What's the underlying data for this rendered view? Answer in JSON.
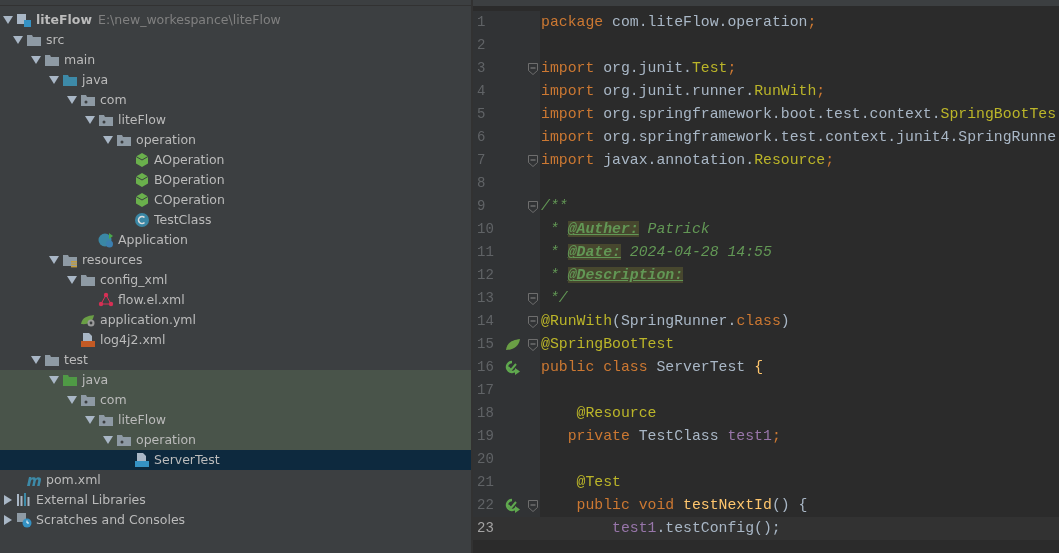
{
  "project_tree": [
    {
      "label": "liteFlow",
      "path": "E:\\new_workespance\\liteFlow",
      "kind": "module",
      "expanded": true,
      "children": [
        {
          "label": "src",
          "kind": "folder",
          "expanded": true,
          "children": [
            {
              "label": "main",
              "kind": "folder",
              "expanded": true,
              "children": [
                {
                  "label": "java",
                  "kind": "source-folder",
                  "expanded": true,
                  "children": [
                    {
                      "label": "com",
                      "kind": "package",
                      "expanded": true,
                      "children": [
                        {
                          "label": "liteFlow",
                          "kind": "package",
                          "expanded": true,
                          "children": [
                            {
                              "label": "operation",
                              "kind": "package",
                              "expanded": true,
                              "children": [
                                {
                                  "label": "AOperation",
                                  "kind": "bean",
                                  "selected": false
                                },
                                {
                                  "label": "BOperation",
                                  "kind": "bean",
                                  "selected": false
                                },
                                {
                                  "label": "COperation",
                                  "kind": "bean",
                                  "selected": false
                                },
                                {
                                  "label": "TestClass",
                                  "kind": "class",
                                  "selected": false
                                }
                              ]
                            }
                          ]
                        },
                        {
                          "label": "Application",
                          "kind": "app",
                          "selected": false
                        }
                      ]
                    }
                  ]
                },
                {
                  "label": "resources",
                  "kind": "resources-folder",
                  "expanded": true,
                  "children": [
                    {
                      "label": "config_xml",
                      "kind": "folder",
                      "expanded": true,
                      "children": [
                        {
                          "label": "flow.el.xml",
                          "kind": "flow-xml",
                          "selected": false
                        }
                      ]
                    },
                    {
                      "label": "application.yml",
                      "kind": "yml",
                      "selected": false
                    },
                    {
                      "label": "log4j2.xml",
                      "kind": "xml",
                      "selected": false
                    }
                  ]
                }
              ]
            },
            {
              "label": "test",
              "kind": "folder",
              "expanded": true,
              "children": [
                {
                  "label": "java",
                  "kind": "test-folder",
                  "expanded": true,
                  "test_sources": true,
                  "children": [
                    {
                      "label": "com",
                      "kind": "package",
                      "expanded": true,
                      "children": [
                        {
                          "label": "liteFlow",
                          "kind": "package",
                          "expanded": true,
                          "children": [
                            {
                              "label": "operation",
                              "kind": "package",
                              "expanded": true,
                              "children": [
                                {
                                  "label": "ServerTest",
                                  "kind": "test-class",
                                  "selected": true
                                }
                              ]
                            }
                          ]
                        }
                      ]
                    }
                  ]
                }
              ]
            }
          ]
        },
        {
          "label": "pom.xml",
          "kind": "maven",
          "selected": false
        }
      ]
    },
    {
      "label": "External Libraries",
      "kind": "libraries",
      "expanded": false
    },
    {
      "label": "Scratches and Consoles",
      "kind": "scratches",
      "expanded": false
    }
  ],
  "editor": {
    "lines": [
      {
        "number": "1",
        "tokens": [
          {
            "kind": "kw",
            "text": "package"
          },
          {
            "kind": "plain",
            "text": " com.liteFlow.operation"
          },
          {
            "kind": "kw",
            "text": ";"
          }
        ]
      },
      {
        "number": "2"
      },
      {
        "number": "3",
        "fold": true,
        "tokens": [
          {
            "kind": "kw",
            "text": "import"
          },
          {
            "kind": "plain",
            "text": " org.junit."
          },
          {
            "kind": "ann",
            "text": "Test"
          },
          {
            "kind": "kw",
            "text": ";"
          }
        ]
      },
      {
        "number": "4",
        "tokens": [
          {
            "kind": "kw",
            "text": "import"
          },
          {
            "kind": "plain",
            "text": " org.junit.runner."
          },
          {
            "kind": "ann",
            "text": "RunWith"
          },
          {
            "kind": "kw",
            "text": ";"
          }
        ]
      },
      {
        "number": "5",
        "tokens": [
          {
            "kind": "kw",
            "text": "import"
          },
          {
            "kind": "plain",
            "text": " org.springframework.boot.test.context."
          },
          {
            "kind": "ann",
            "text": "SpringBootTes"
          }
        ]
      },
      {
        "number": "6",
        "tokens": [
          {
            "kind": "kw",
            "text": "import"
          },
          {
            "kind": "plain",
            "text": " org.springframework.test.context.junit4.SpringRunne"
          }
        ]
      },
      {
        "number": "7",
        "fold": true,
        "tokens": [
          {
            "kind": "kw",
            "text": "import"
          },
          {
            "kind": "plain",
            "text": " javax.annotation."
          },
          {
            "kind": "ann",
            "text": "Resource"
          },
          {
            "kind": "kw",
            "text": ";"
          }
        ]
      },
      {
        "number": "8"
      },
      {
        "number": "9",
        "fold": true,
        "tokens": [
          {
            "kind": "doc",
            "text": "/**"
          }
        ]
      },
      {
        "number": "10",
        "tokens": [
          {
            "kind": "doc",
            "text": " * "
          },
          {
            "kind": "doctag",
            "text": "@Auther:"
          },
          {
            "kind": "doc",
            "text": " Patrick"
          }
        ]
      },
      {
        "number": "11",
        "tokens": [
          {
            "kind": "doc",
            "text": " * "
          },
          {
            "kind": "doctag",
            "text": "@Date:"
          },
          {
            "kind": "doc",
            "text": " 2024-04-28 14:55"
          }
        ]
      },
      {
        "number": "12",
        "tokens": [
          {
            "kind": "doc",
            "text": " * "
          },
          {
            "kind": "doctag",
            "text": "@Description:"
          }
        ]
      },
      {
        "number": "13",
        "fold": true,
        "tokens": [
          {
            "kind": "doc",
            "text": " */"
          }
        ]
      },
      {
        "number": "14",
        "fold": true,
        "tokens": [
          {
            "kind": "ann",
            "text": "@RunWith"
          },
          {
            "kind": "plain",
            "text": "(SpringRunner."
          },
          {
            "kind": "kw",
            "text": "class"
          },
          {
            "kind": "plain",
            "text": ")"
          }
        ]
      },
      {
        "number": "15",
        "fold": true,
        "marker": {
          "kind": "bean"
        },
        "tokens": [
          {
            "kind": "ann",
            "text": "@SpringBootTest"
          }
        ]
      },
      {
        "number": "16",
        "marker": {
          "kind": "run"
        },
        "tokens": [
          {
            "kind": "kw",
            "text": "public class"
          },
          {
            "kind": "plain",
            "text": " ServerTest "
          },
          {
            "kind": "method",
            "text": "{"
          }
        ]
      },
      {
        "number": "17"
      },
      {
        "number": "18",
        "tokens": [
          {
            "kind": "ann",
            "text": "    @Resource"
          }
        ]
      },
      {
        "number": "19",
        "tokens": [
          {
            "kind": "kw",
            "text": "   private"
          },
          {
            "kind": "plain",
            "text": " TestClass "
          },
          {
            "kind": "field",
            "text": "test1"
          },
          {
            "kind": "kw",
            "text": ";"
          }
        ]
      },
      {
        "number": "20"
      },
      {
        "number": "21",
        "tokens": [
          {
            "kind": "ann",
            "text": "    @Test"
          }
        ]
      },
      {
        "number": "22",
        "fold": true,
        "marker": {
          "kind": "run"
        },
        "tokens": [
          {
            "kind": "kw",
            "text": "    public void"
          },
          {
            "kind": "method",
            "text": " testNextId"
          },
          {
            "kind": "plain",
            "text": "() {"
          }
        ]
      },
      {
        "number": "23",
        "current": true,
        "tokens": [
          {
            "kind": "field",
            "text": "        test1"
          },
          {
            "kind": "plain",
            "text": ".testConfig();"
          }
        ]
      }
    ]
  }
}
